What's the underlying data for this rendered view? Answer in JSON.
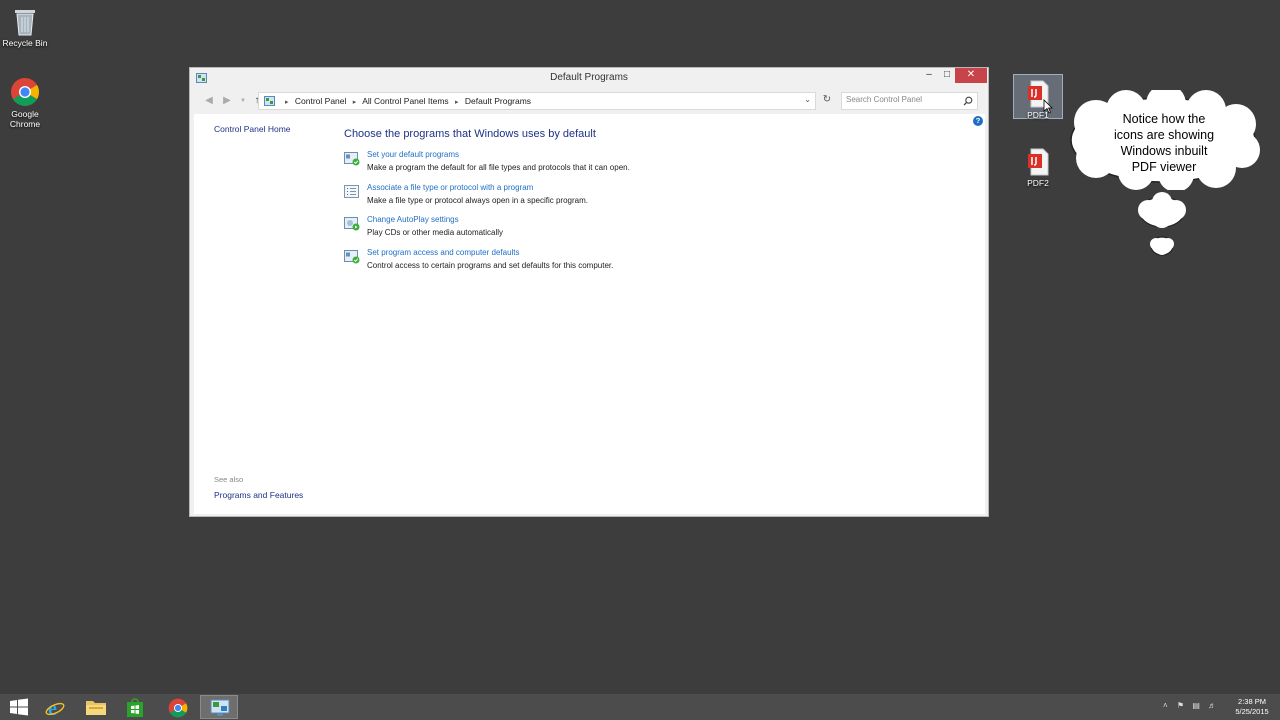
{
  "desktop": {
    "recycle_bin": "Recycle Bin",
    "chrome_line1": "Google",
    "chrome_line2": "Chrome",
    "pdf1": "PDF1",
    "pdf2": "PDF2"
  },
  "window": {
    "title": "Default Programs",
    "breadcrumb": [
      "Control Panel",
      "All Control Panel Items",
      "Default Programs"
    ],
    "search_placeholder": "Search Control Panel",
    "sidebar": {
      "home": "Control Panel Home",
      "see_also": "See also",
      "programs_features": "Programs and Features"
    },
    "heading": "Choose the programs that Windows uses by default",
    "options": [
      {
        "link": "Set your default programs",
        "desc": "Make a program the default for all file types and protocols that it can open."
      },
      {
        "link": "Associate a file type or protocol with a program",
        "desc": "Make a file type or protocol always open in a specific program."
      },
      {
        "link": "Change AutoPlay settings",
        "desc": "Play CDs or other media automatically"
      },
      {
        "link": "Set program access and computer defaults",
        "desc": "Control access to certain programs and set defaults for this computer."
      }
    ]
  },
  "annotation": {
    "line1": "Notice how the",
    "line2": "icons are showing",
    "line3": "Windows inbuilt",
    "line4": "PDF viewer"
  },
  "taskbar": {
    "time": "2:38 PM",
    "date": "5/25/2015"
  },
  "colors": {
    "link": "#1e6fc4",
    "heading": "#1e3287",
    "close": "#c7444b",
    "pdf_red": "#d9302a"
  }
}
